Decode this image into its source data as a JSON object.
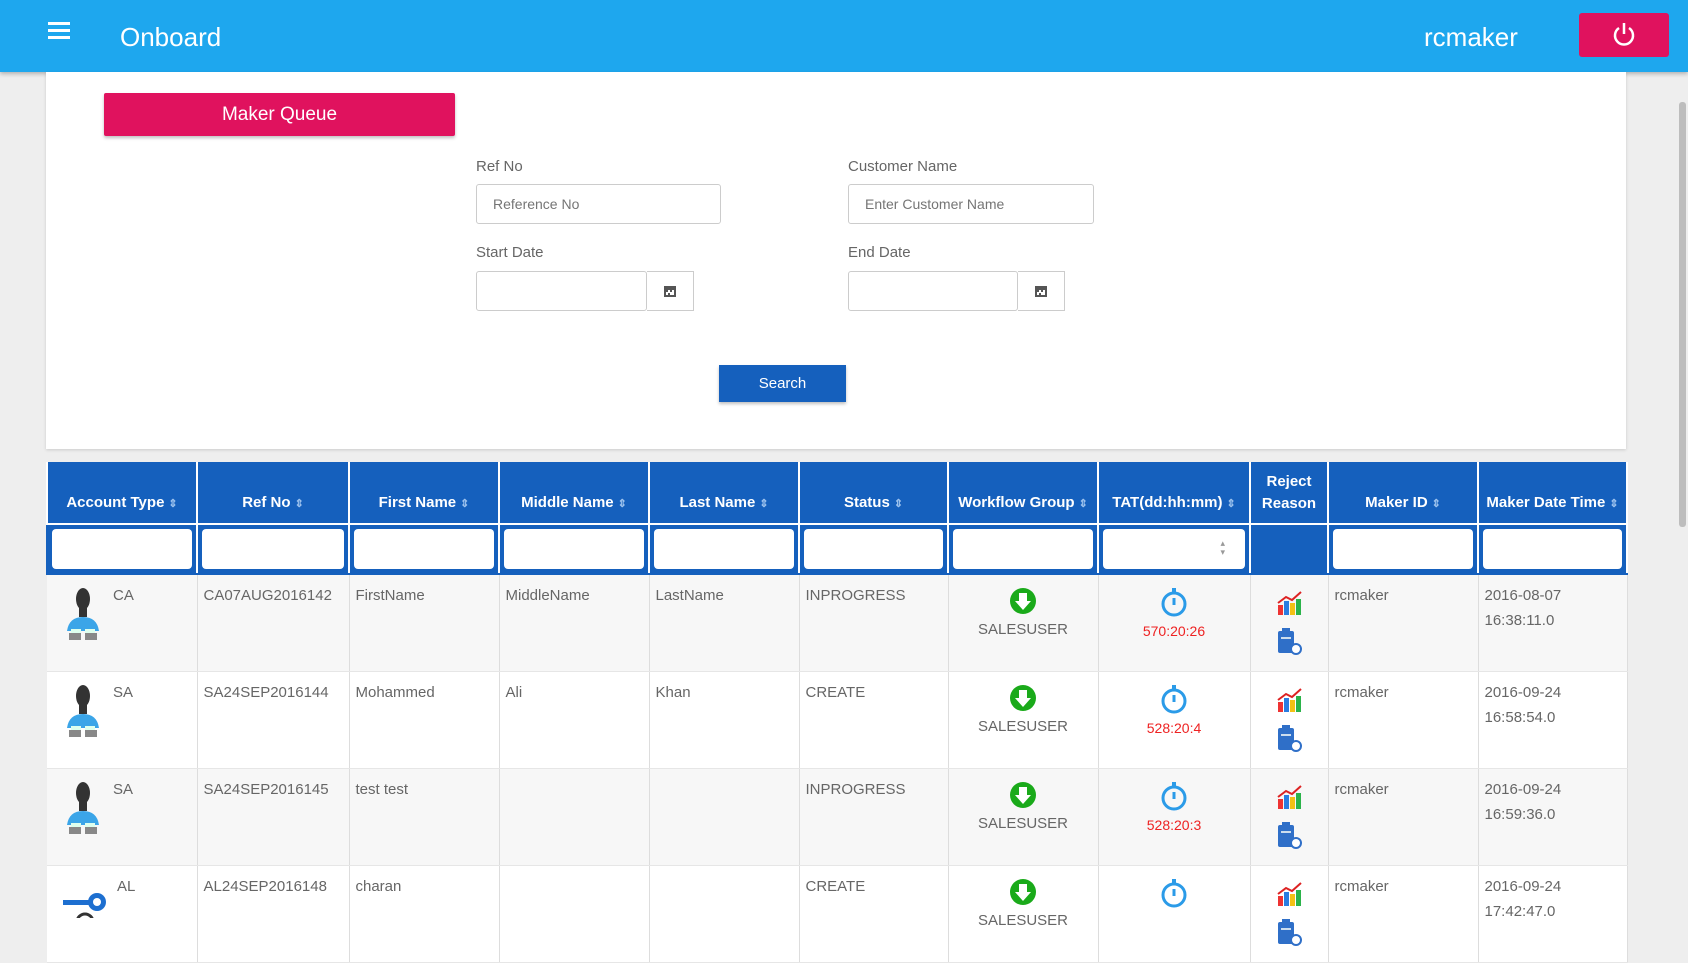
{
  "header": {
    "title": "Onboard",
    "username": "rcmaker",
    "menu_icon": "hamburger-icon",
    "logout_icon": "power-icon"
  },
  "form": {
    "queue_button": "Maker Queue",
    "ref_no_label": "Ref No",
    "ref_no_placeholder": "Reference No",
    "ref_no_value": "",
    "customer_name_label": "Customer Name",
    "customer_name_placeholder": "Enter Customer Name",
    "customer_name_value": "",
    "start_date_label": "Start Date",
    "start_date_value": "",
    "end_date_label": "End Date",
    "end_date_value": "",
    "search_button": "Search"
  },
  "table": {
    "columns": [
      "Account Type",
      "Ref No",
      "First Name",
      "Middle Name",
      "Last Name",
      "Status",
      "Workflow Group",
      "TAT(dd:hh:mm)",
      "Reject Reason",
      "Maker ID",
      "Maker Date Time"
    ],
    "rows": [
      {
        "account_type": "CA",
        "icon": "person-icon",
        "ref_no": "CA07AUG2016142",
        "first_name": "FirstName",
        "middle_name": "MiddleName",
        "last_name": "LastName",
        "status": "INPROGRESS",
        "workflow_group": "SALESUSER",
        "tat": "570:20:26",
        "maker_id": "rcmaker",
        "date": "2016-08-07",
        "time": "16:38:11.0"
      },
      {
        "account_type": "SA",
        "icon": "person-icon",
        "ref_no": "SA24SEP2016144",
        "first_name": "Mohammed",
        "middle_name": "Ali",
        "last_name": "Khan",
        "status": "CREATE",
        "workflow_group": "SALESUSER",
        "tat": "528:20:4",
        "maker_id": "rcmaker",
        "date": "2016-09-24",
        "time": "16:58:54.0"
      },
      {
        "account_type": "SA",
        "icon": "person-icon",
        "ref_no": "SA24SEP2016145",
        "first_name": "test test",
        "middle_name": "",
        "last_name": "",
        "status": "INPROGRESS",
        "workflow_group": "SALESUSER",
        "tat": "528:20:3",
        "maker_id": "rcmaker",
        "date": "2016-09-24",
        "time": "16:59:36.0"
      },
      {
        "account_type": "AL",
        "icon": "key-icon",
        "ref_no": "AL24SEP2016148",
        "first_name": "charan",
        "middle_name": "",
        "last_name": "",
        "status": "CREATE",
        "workflow_group": "SALESUSER",
        "tat": "",
        "maker_id": "rcmaker",
        "date": "2016-09-24",
        "time": "17:42:47.0"
      }
    ]
  },
  "colors": {
    "topbar": "#1ea7ee",
    "accent": "#e0125e",
    "table_header": "#1560bd",
    "tat": "#e22222",
    "workflow": "#1aaa1a"
  }
}
